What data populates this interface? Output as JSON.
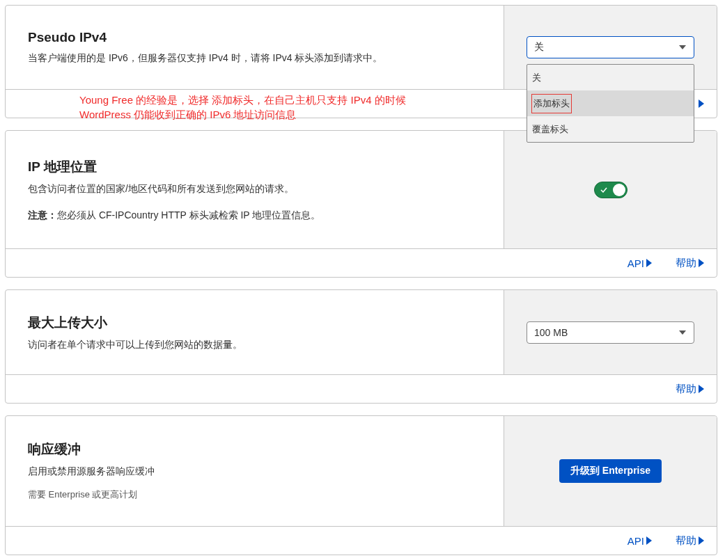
{
  "settings": [
    {
      "title": "Pseudo IPv4",
      "descriptions": [
        {
          "text": "当客户端使用的是 IPv6，但服务器仅支持 IPv4 时，请将 IPv4 标头添加到请求中。",
          "kind": "normal"
        }
      ],
      "control": {
        "kind": "select",
        "value": "关",
        "open": true,
        "options": [
          {
            "label": "关",
            "highlighted": false,
            "boxed": false
          },
          {
            "label": "添加标头",
            "highlighted": true,
            "boxed": true
          },
          {
            "label": "覆盖标头",
            "highlighted": false,
            "boxed": false
          }
        ]
      },
      "footer": {
        "covered_link": true
      },
      "annotation": [
        "Young Free 的经验是，选择 添加标头，在自己主机只支持 IPv4 的时候",
        "WordPress 仍能收到正确的 IPv6 地址访问信息"
      ]
    },
    {
      "title": "IP 地理位置",
      "descriptions": [
        {
          "text": "包含访问者位置的国家/地区代码和所有发送到您网站的请求。",
          "kind": "normal"
        },
        {
          "text": "**注意：**您必须从 CF-IPCountry HTTP 标头减检索 IP 地理位置信息。",
          "kind": "note"
        }
      ],
      "control": {
        "kind": "toggle",
        "on": true
      },
      "footer": {
        "links": [
          "API",
          "帮助"
        ]
      }
    },
    {
      "title": "最大上传大小",
      "descriptions": [
        {
          "text": "访问者在单个请求中可以上传到您网站的数据量。",
          "kind": "normal"
        }
      ],
      "control": {
        "kind": "select",
        "value": "100 MB",
        "open": false
      },
      "footer": {
        "links": [
          "帮助"
        ]
      }
    },
    {
      "title": "响应缓冲",
      "descriptions": [
        {
          "text": "启用或禁用源服务器响应缓冲",
          "kind": "normal"
        },
        {
          "text": "需要 Enterprise 或更高计划",
          "kind": "small"
        }
      ],
      "control": {
        "kind": "button",
        "label": "升级到 Enterprise"
      },
      "footer": {
        "links": [
          "API",
          "帮助"
        ]
      }
    }
  ]
}
